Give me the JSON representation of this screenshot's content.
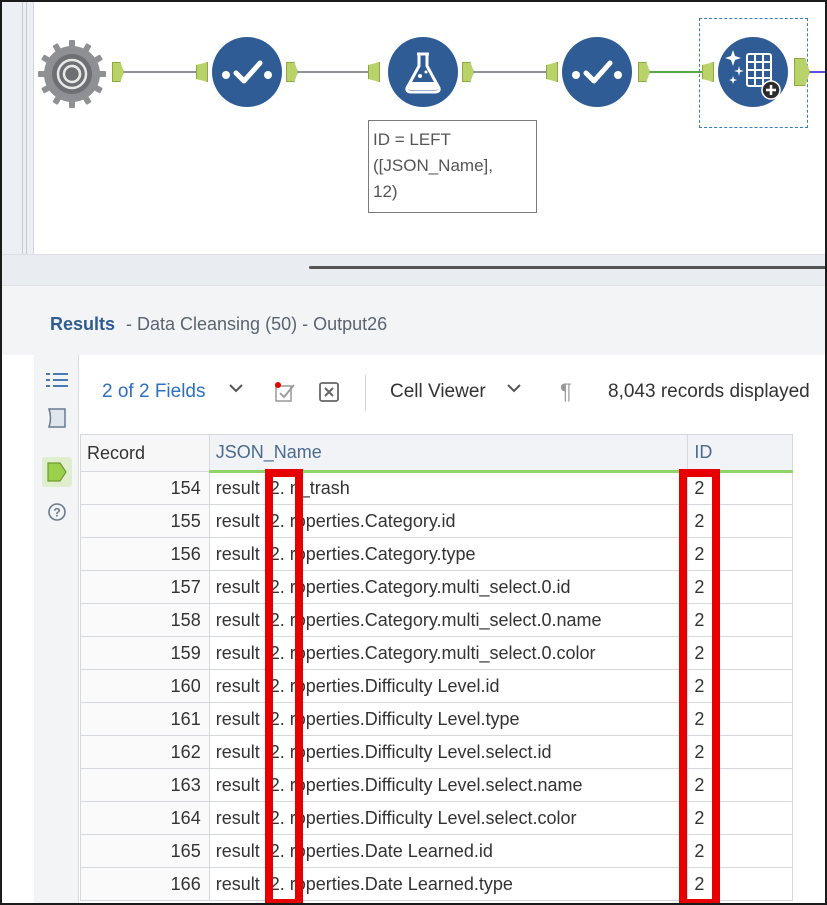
{
  "workflow": {
    "formula_annotation": "ID = LEFT\n([JSON_Name],\n12)"
  },
  "results": {
    "title": "Results",
    "subtitle": "- Data Cleansing (50) - Output26"
  },
  "toolbar": {
    "fields_label": "2 of 2 Fields",
    "cell_viewer_label": "Cell Viewer",
    "records_label": "8,043 records displayed"
  },
  "grid": {
    "columns": [
      "Record",
      "JSON_Name",
      "ID"
    ],
    "rows": [
      {
        "record": "154",
        "json_name": "result .2.  n_trash",
        "id": "2"
      },
      {
        "record": "155",
        "json_name": "result .2.  roperties.Category.id",
        "id": "2"
      },
      {
        "record": "156",
        "json_name": "result .2.  roperties.Category.type",
        "id": "2"
      },
      {
        "record": "157",
        "json_name": "result .2.  roperties.Category.multi_select.0.id",
        "id": "2"
      },
      {
        "record": "158",
        "json_name": "result .2.  roperties.Category.multi_select.0.name",
        "id": "2"
      },
      {
        "record": "159",
        "json_name": "result .2.  roperties.Category.multi_select.0.color",
        "id": "2"
      },
      {
        "record": "160",
        "json_name": "result .2.  roperties.Difficulty Level.id",
        "id": "2"
      },
      {
        "record": "161",
        "json_name": "result .2.  roperties.Difficulty Level.type",
        "id": "2"
      },
      {
        "record": "162",
        "json_name": "result .2.  roperties.Difficulty Level.select.id",
        "id": "2"
      },
      {
        "record": "163",
        "json_name": "result .2.  roperties.Difficulty Level.select.name",
        "id": "2"
      },
      {
        "record": "164",
        "json_name": "result .2.  roperties.Difficulty Level.select.color",
        "id": "2"
      },
      {
        "record": "165",
        "json_name": "result .2.  roperties.Date Learned.id",
        "id": "2"
      },
      {
        "record": "166",
        "json_name": "result .2.  roperties.Date Learned.type",
        "id": "2"
      }
    ]
  },
  "icons": {
    "input_tool": "json-input-icon",
    "select_tool": "select-check-icon",
    "formula_tool": "formula-flask-icon",
    "cleanse_tool": "data-cleansing-icon"
  },
  "colors": {
    "tool_blue": "#2f5c94",
    "anchor_green": "#b9d36a",
    "highlight_red": "#e60000",
    "header_underline": "#8fd468"
  }
}
